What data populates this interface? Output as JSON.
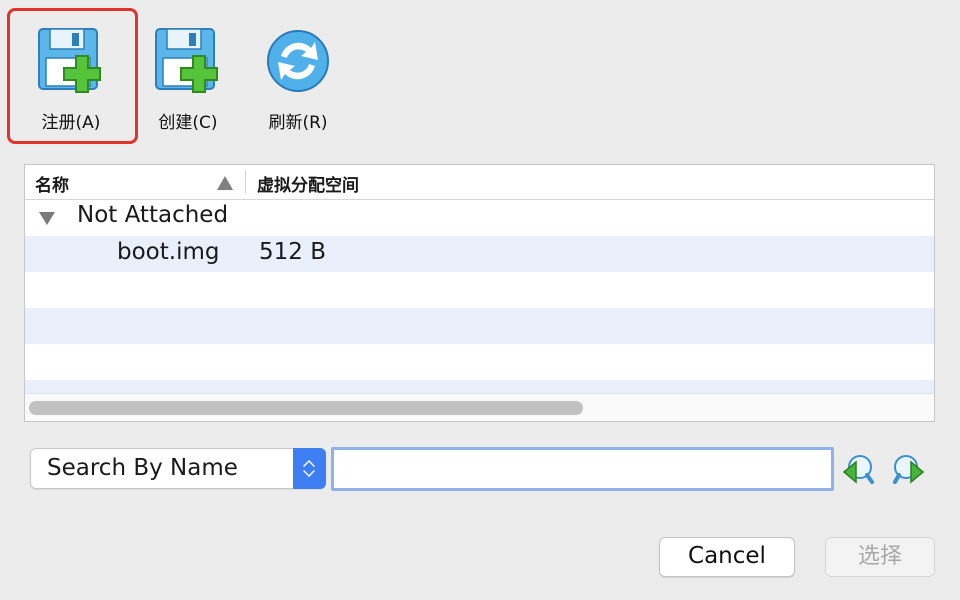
{
  "toolbar": {
    "register_label": "注册(A)",
    "create_label": "创建(C)",
    "refresh_label": "刷新(R)"
  },
  "tree": {
    "columns": {
      "name": "名称",
      "virtual_size": "虚拟分配空间"
    },
    "group": {
      "label": "Not Attached"
    },
    "items": [
      {
        "name": "boot.img",
        "size": "512 B"
      }
    ]
  },
  "search": {
    "mode_selected": "Search By Name",
    "query": ""
  },
  "dialog": {
    "cancel_label": "Cancel",
    "choose_label": "选择"
  },
  "colors": {
    "highlight": "#e2332b",
    "accent": "#3d7ff2",
    "row_alt": "#e9f0fb"
  },
  "icons": {
    "register": "floppy-add-icon",
    "create": "floppy-add-icon",
    "refresh": "refresh-icon",
    "prev": "search-prev-icon",
    "next": "search-next-icon"
  }
}
